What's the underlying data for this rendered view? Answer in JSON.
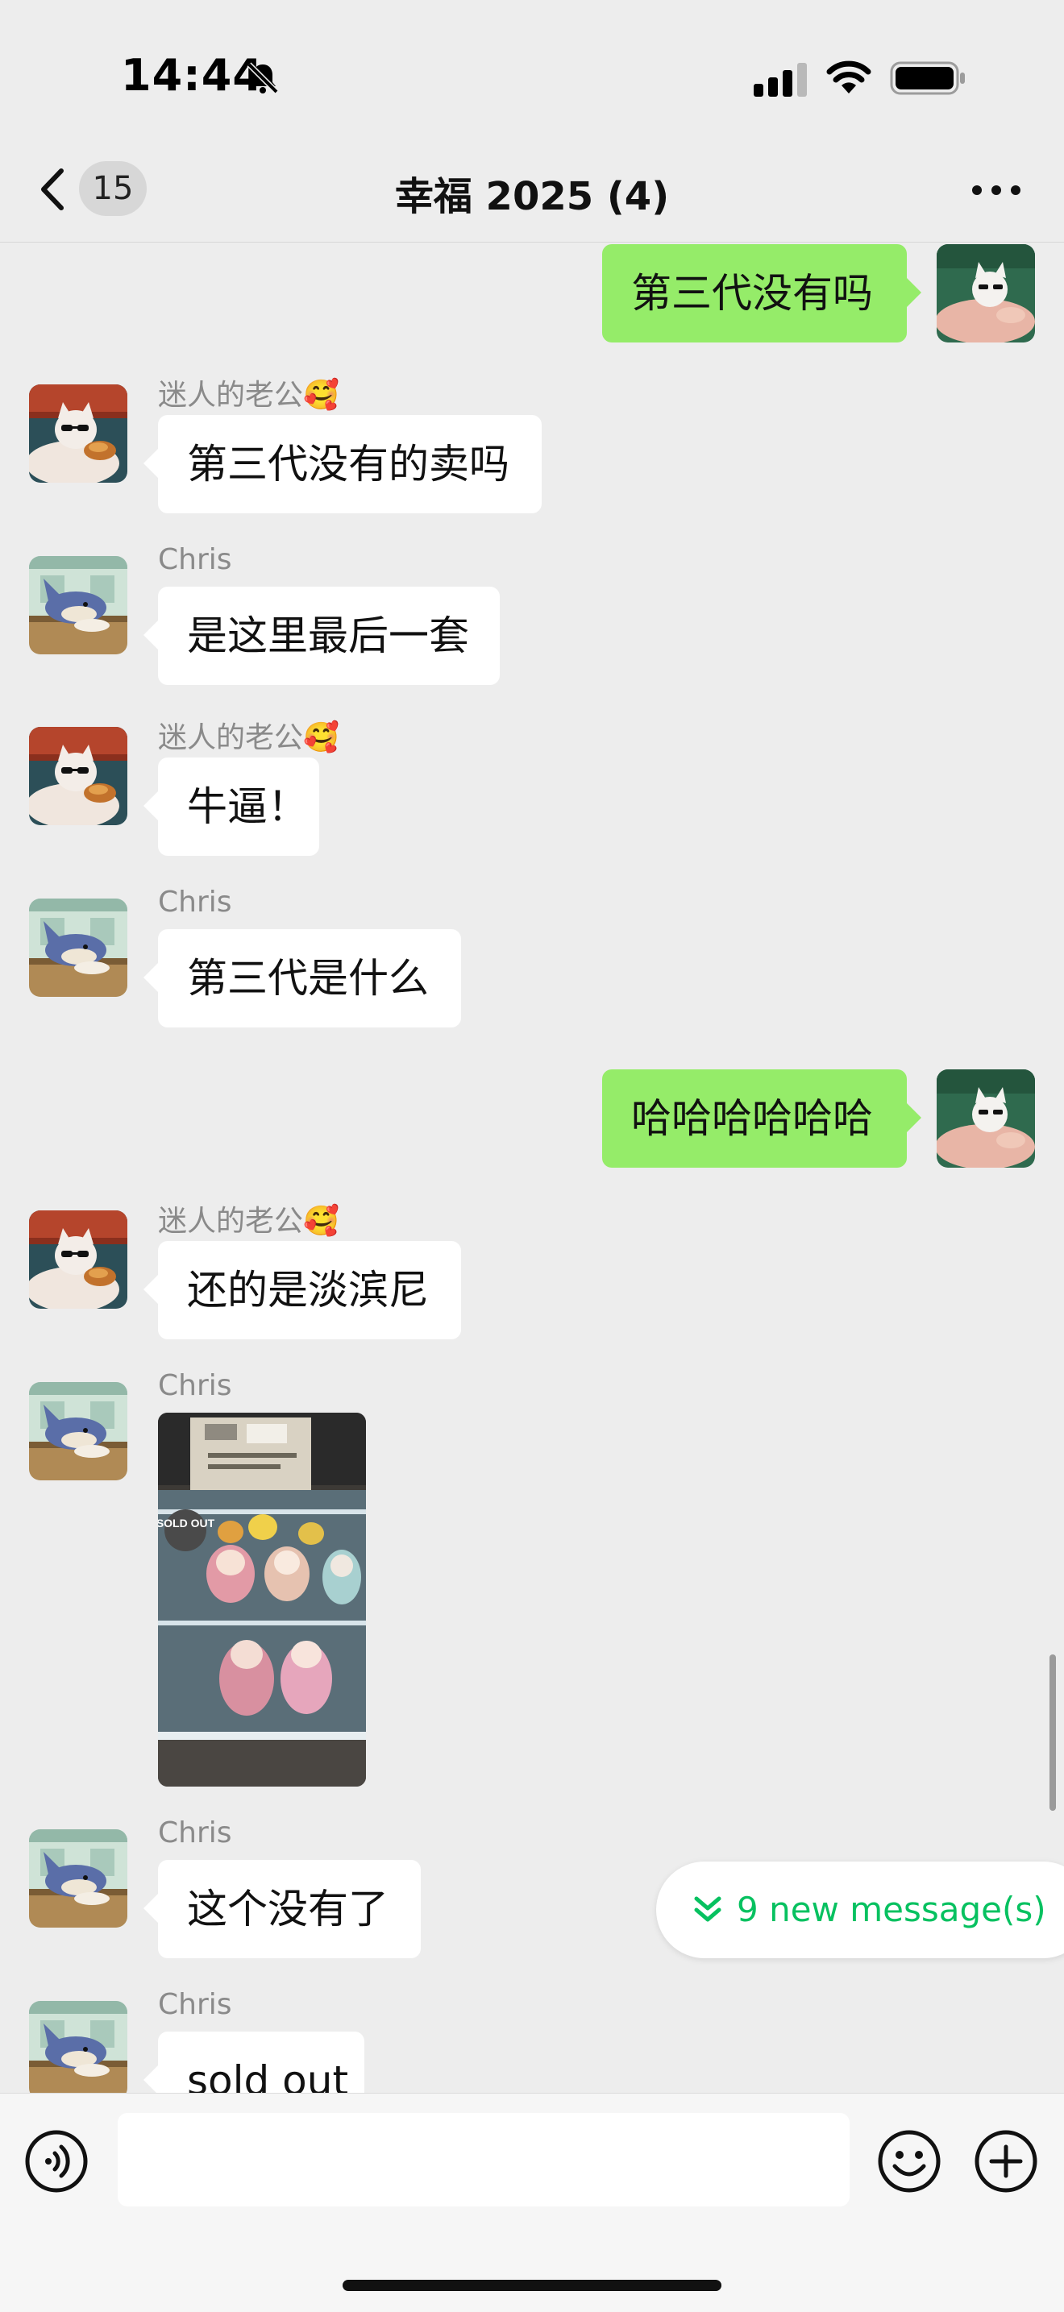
{
  "status_bar": {
    "time": "14:44",
    "icons": [
      "bell-slash-icon",
      "cellular-signal-icon",
      "wifi-icon",
      "battery-icon"
    ]
  },
  "header": {
    "unread_count": "15",
    "title": "幸福 2025 (4)",
    "back_icon": "chevron-left-icon",
    "more_icon": "ellipsis-icon"
  },
  "messages": [
    {
      "direction": "out",
      "type": "text",
      "text": "第三代没有吗"
    },
    {
      "direction": "in",
      "sender": "迷人的老公🥰",
      "type": "text",
      "text": "第三代没有的卖吗"
    },
    {
      "direction": "in",
      "sender": "Chris",
      "type": "text",
      "text": "是这里最后一套"
    },
    {
      "direction": "in",
      "sender": "迷人的老公🥰",
      "type": "text",
      "text": "牛逼！"
    },
    {
      "direction": "in",
      "sender": "Chris",
      "type": "text",
      "text": "第三代是什么"
    },
    {
      "direction": "out",
      "type": "text",
      "text": "哈哈哈哈哈哈"
    },
    {
      "direction": "in",
      "sender": "迷人的老公🥰",
      "type": "text",
      "text": "还的是淡滨尼"
    },
    {
      "direction": "in",
      "sender": "Chris",
      "type": "image",
      "image_label": "SOLD OUT"
    },
    {
      "direction": "in",
      "sender": "Chris",
      "type": "text",
      "text": "这个没有了"
    },
    {
      "direction": "in",
      "sender": "Chris",
      "type": "text",
      "text": "sold out"
    }
  ],
  "new_messages": {
    "label": "9 new message(s)",
    "icon": "double-chevron-down-icon"
  },
  "input_bar": {
    "text_value": "",
    "voice_icon": "voice-icon",
    "emoji_icon": "emoji-icon",
    "plus_icon": "plus-icon"
  },
  "colors": {
    "background": "#ededed",
    "outgoing_bubble": "#95ec69",
    "incoming_bubble": "#ffffff",
    "accent": "#07c160",
    "sender_name": "#8a8a8a"
  }
}
